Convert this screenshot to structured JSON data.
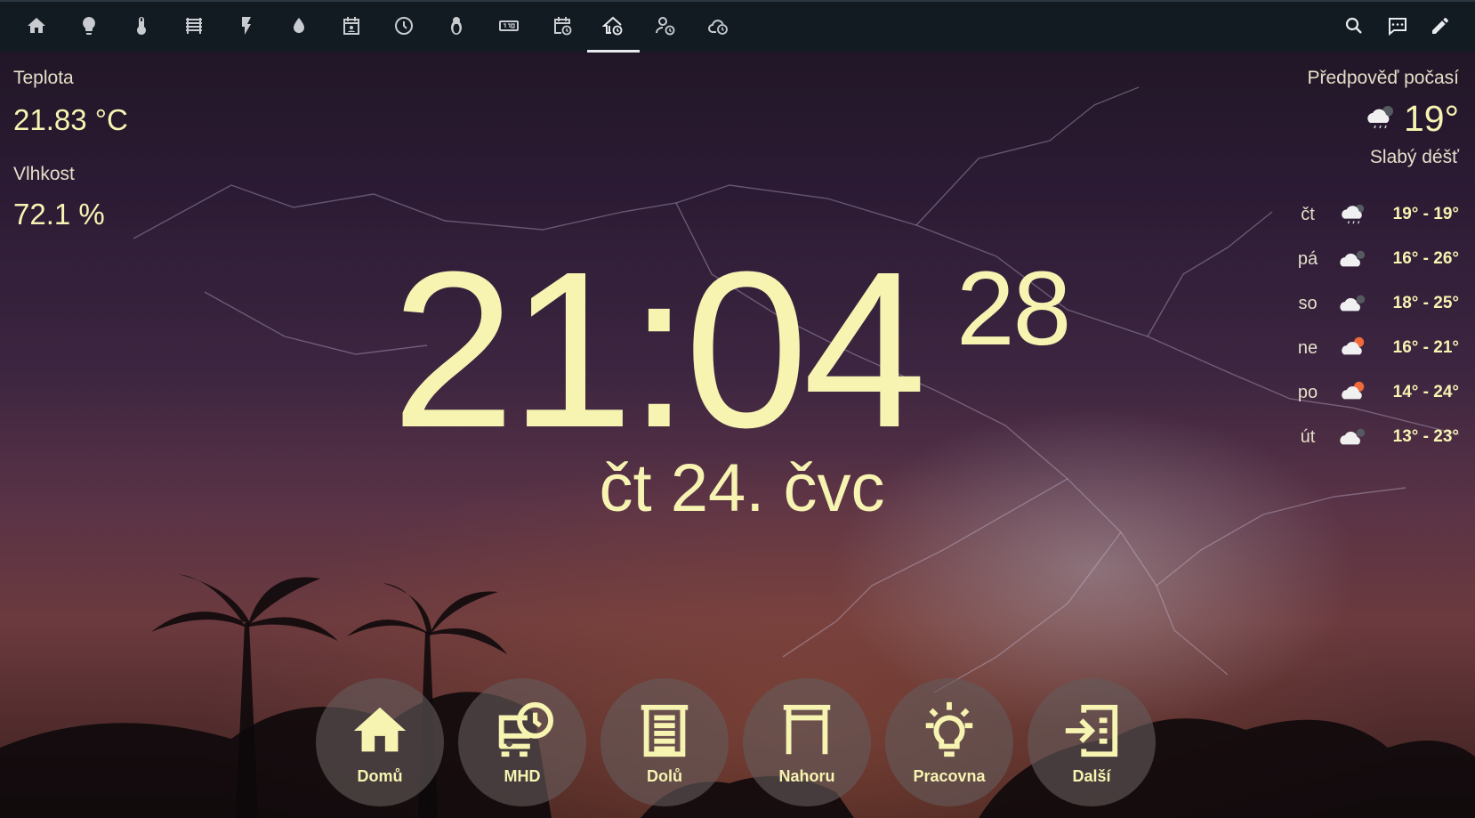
{
  "topbar": {
    "icons": [
      "home-icon",
      "lightbulb-icon",
      "thermometer-icon",
      "radiator-icon",
      "flash-icon",
      "water-icon",
      "calendar-account-icon",
      "clock-icon",
      "penguin-icon",
      "clock-digital-icon",
      "calendar-clock-icon",
      "home-clock-icon",
      "account-clock-icon",
      "cloud-clock-icon"
    ],
    "right_icons": [
      "search-icon",
      "chat-icon",
      "pencil-icon"
    ],
    "active_index": 11
  },
  "sensors": {
    "temperature_label": "Teplota",
    "temperature_value": "21.83 °C",
    "humidity_label": "Vlhkost",
    "humidity_value": "72.1 %"
  },
  "clock": {
    "time": "21:04",
    "seconds": "28",
    "date": "čt 24. čvc"
  },
  "weather": {
    "title": "Předpověď počasí",
    "current_temp": "19°",
    "condition": "Slabý déšť",
    "forecast": [
      {
        "day": "čt",
        "icon": "cloud-rain-night-icon",
        "temp": "19° - 19°"
      },
      {
        "day": "pá",
        "icon": "cloud-icon",
        "temp": "16° - 26°"
      },
      {
        "day": "so",
        "icon": "cloud-icon",
        "temp": "18° - 25°"
      },
      {
        "day": "ne",
        "icon": "partly-sunny-icon",
        "temp": "16° - 21°"
      },
      {
        "day": "po",
        "icon": "partly-sunny-icon",
        "temp": "14° - 24°"
      },
      {
        "day": "út",
        "icon": "cloud-icon",
        "temp": "13° - 23°"
      }
    ]
  },
  "nav_buttons": [
    {
      "label": "Domů",
      "icon": "home-icon"
    },
    {
      "label": "MHD",
      "icon": "bus-clock-icon"
    },
    {
      "label": "Dolů",
      "icon": "blinds-closed-icon"
    },
    {
      "label": "Nahoru",
      "icon": "blinds-open-icon"
    },
    {
      "label": "Pracovna",
      "icon": "lightbulb-on-icon"
    },
    {
      "label": "Další",
      "icon": "login-list-icon"
    }
  ],
  "colors": {
    "accent_text": "#f7f4b2",
    "topbar_bg": "#121b22",
    "icon_grey": "#c8ccd0"
  }
}
